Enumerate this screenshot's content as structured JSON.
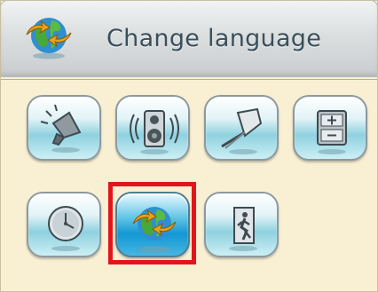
{
  "header": {
    "title": "Change language",
    "icon": "globe-arrows-icon"
  },
  "buttons": [
    {
      "name": "speaker-volume-button",
      "icon": "loudspeaker-icon"
    },
    {
      "name": "sound-settings-button",
      "icon": "speaker-box-icon"
    },
    {
      "name": "calibration-button",
      "icon": "stylus-calibrate-icon"
    },
    {
      "name": "battery-power-button",
      "icon": "battery-icon"
    },
    {
      "name": "time-settings-button",
      "icon": "clock-icon"
    },
    {
      "name": "change-language-button",
      "icon": "globe-arrows-icon",
      "selected": true
    },
    {
      "name": "exit-button",
      "icon": "exit-door-icon"
    }
  ],
  "colors": {
    "background": "#f9efd2",
    "header": "#dcdfe0",
    "selection": "#e2151b",
    "title": "#3a4f5b"
  }
}
